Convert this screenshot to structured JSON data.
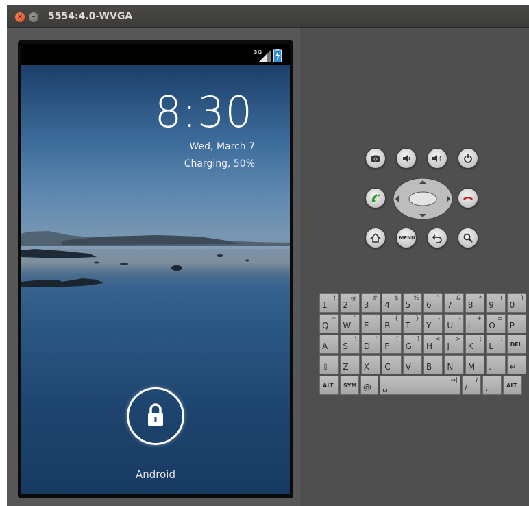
{
  "window": {
    "title": "5554:4.0-WVGA",
    "close_glyph": "×",
    "min_glyph": "–"
  },
  "statusbar": {
    "network": "3G"
  },
  "lockscreen": {
    "time": "8:30",
    "date": "Wed, March 7",
    "charging": "Charging, 50%",
    "carrier": "Android"
  },
  "hardware_buttons": [
    {
      "name": "camera-button",
      "icon": "camera-icon"
    },
    {
      "name": "volume-down-button",
      "icon": "volume-down-icon"
    },
    {
      "name": "volume-up-button",
      "icon": "volume-up-icon"
    },
    {
      "name": "power-button",
      "icon": "power-icon"
    },
    {
      "name": "call-button",
      "icon": "phone-green-icon"
    },
    {
      "name": "end-call-button",
      "icon": "phone-red-icon"
    },
    {
      "name": "home-button",
      "icon": "home-icon"
    },
    {
      "name": "menu-button",
      "icon": "menu-icon",
      "label": "MENU"
    },
    {
      "name": "back-button",
      "icon": "back-icon"
    },
    {
      "name": "search-button",
      "icon": "search-icon"
    }
  ],
  "keyboard": {
    "row1": [
      [
        "1",
        "!"
      ],
      [
        "2",
        "@"
      ],
      [
        "3",
        "#"
      ],
      [
        "4",
        "$"
      ],
      [
        "5",
        "%"
      ],
      [
        "6",
        "^"
      ],
      [
        "7",
        "&"
      ],
      [
        "8",
        "*"
      ],
      [
        "9",
        "("
      ],
      [
        "0",
        ")"
      ]
    ],
    "row2": [
      [
        "Q",
        "~"
      ],
      [
        "W",
        "\""
      ],
      [
        "E",
        "`"
      ],
      [
        "R",
        "{"
      ],
      [
        "T",
        "}"
      ],
      [
        "Y",
        "-"
      ],
      [
        "U",
        "-"
      ],
      [
        "I",
        "+"
      ],
      [
        "O",
        "="
      ],
      [
        "P",
        ""
      ]
    ],
    "row3": [
      [
        "A",
        ""
      ],
      [
        "S",
        "\\"
      ],
      [
        "D",
        "'"
      ],
      [
        "F",
        "["
      ],
      [
        "G",
        "]"
      ],
      [
        "H",
        "<"
      ],
      [
        "J",
        ">"
      ],
      [
        "K",
        ";"
      ],
      [
        "L",
        ":"
      ],
      [
        "DEL",
        ""
      ]
    ],
    "row4": [
      [
        "⇧",
        ""
      ],
      [
        "Z",
        ""
      ],
      [
        "X",
        ""
      ],
      [
        "C",
        ""
      ],
      [
        "V",
        ""
      ],
      [
        "B",
        ""
      ],
      [
        "N",
        ""
      ],
      [
        "M",
        ""
      ],
      [
        ".",
        ""
      ],
      [
        "↵",
        ""
      ]
    ],
    "row5": [
      [
        "ALT",
        ""
      ],
      [
        "SYM",
        ""
      ],
      [
        "@",
        ""
      ],
      [
        "␣",
        "→|"
      ],
      [
        "/",
        "?"
      ],
      [
        ",",
        ""
      ],
      [
        "ALT",
        ""
      ]
    ]
  }
}
